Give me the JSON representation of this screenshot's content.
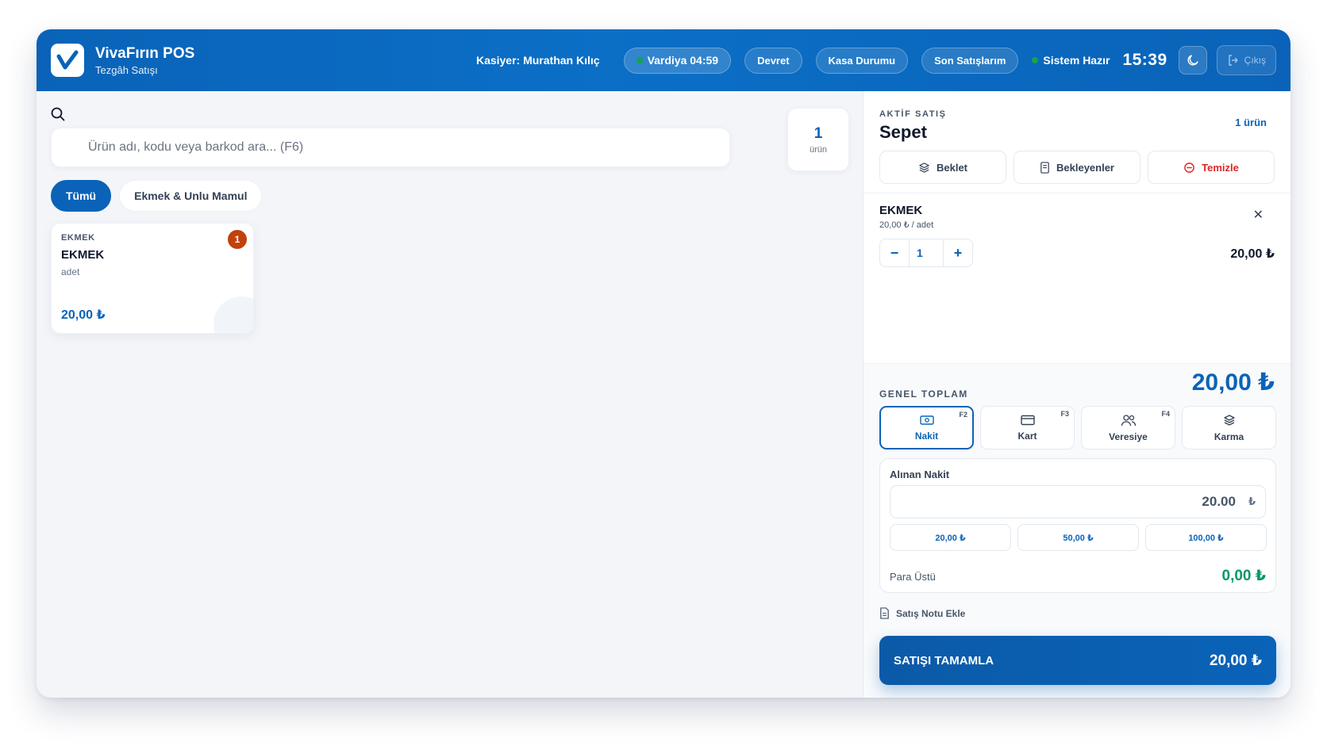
{
  "header": {
    "app_title": "VivaFırın POS",
    "app_subtitle": "Tezgâh Satışı",
    "cashier": "Kasiyer: Murathan Kılıç",
    "shift": "Vardiya 04:59",
    "buttons": {
      "transfer": "Devret",
      "register_status": "Kasa Durumu",
      "last_sales": "Son Satışlarım"
    },
    "status": "Sistem Hazır",
    "clock": "15:39",
    "logout": "Çıkış",
    "colors": {
      "primary": "#0a63b8",
      "status_dot": "#16a34a"
    }
  },
  "search": {
    "placeholder": "Ürün adı, kodu veya barkod ara...  (F6)",
    "count_value": "1",
    "count_label": "ürün"
  },
  "categories": [
    {
      "label": "Tümü",
      "active": true
    },
    {
      "label": "Ekmek & Unlu Mamul",
      "active": false
    }
  ],
  "products": [
    {
      "category": "EKMEK",
      "name": "EKMEK",
      "unit": "adet",
      "price": "20,00 ₺",
      "badge": "1"
    }
  ],
  "cart": {
    "kicker": "AKTİF SATIŞ",
    "title": "Sepet",
    "item_count": "1 ürün",
    "actions": {
      "hold": "Beklet",
      "held": "Bekleyenler",
      "clear": "Temizle"
    },
    "lines": [
      {
        "name": "EKMEK",
        "unit_price": "20,00 ₺ / adet",
        "qty": "1",
        "total": "20,00 ₺"
      }
    ]
  },
  "summary": {
    "label": "GENEL TOPLAM",
    "total": "20,00 ₺",
    "payment_methods": [
      {
        "label": "Nakit",
        "key": "F2",
        "icon": "cash-icon",
        "active": true
      },
      {
        "label": "Kart",
        "key": "F3",
        "icon": "card-icon",
        "active": false
      },
      {
        "label": "Veresiye",
        "key": "F4",
        "icon": "users-icon",
        "active": false
      },
      {
        "label": "Karma",
        "key": "",
        "icon": "layers-icon",
        "active": false
      }
    ],
    "cash": {
      "label": "Alınan Nakit",
      "value": "20.00",
      "currency": "₺",
      "quick_amounts": [
        "20,00 ₺",
        "50,00 ₺",
        "100,00 ₺"
      ],
      "change_label": "Para Üstü",
      "change_value": "0,00 ₺"
    },
    "note": "Satış Notu Ekle",
    "complete": {
      "label": "SATIŞI TAMAMLA",
      "amount": "20,00 ₺"
    }
  }
}
